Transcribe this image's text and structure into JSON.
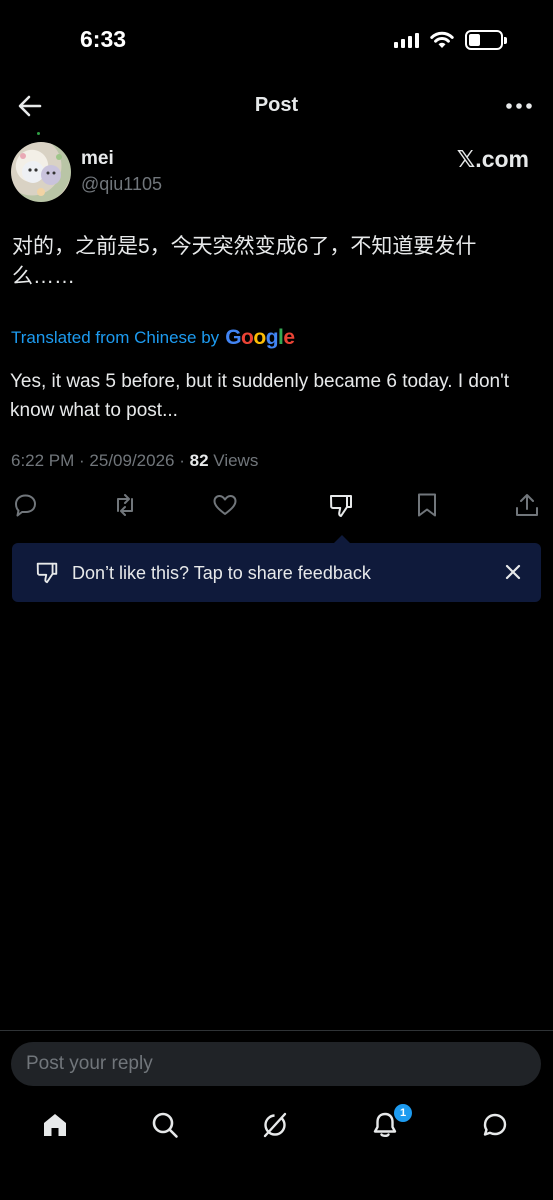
{
  "status_bar": {
    "time": "6:33",
    "battery_level": 0.35
  },
  "header": {
    "title": "Post"
  },
  "author": {
    "display_name": "mei",
    "handle": "@qiu1105",
    "source_label": "𝕏.com"
  },
  "post": {
    "text": "对的，之前是5，今天突然变成6了，不知道要发什么……",
    "translated_prefix": "Translated from Chinese by",
    "translator": "Google",
    "translation": "Yes, it was 5 before, but it suddenly became 6 today. I don't know what to post...",
    "time": "6:22 PM",
    "date": "25/09/2026",
    "views_count": "82",
    "views_label": "Views"
  },
  "tooltip": {
    "text": "Don’t like this? Tap to share feedback"
  },
  "reply": {
    "placeholder": "Post your reply"
  },
  "nav": {
    "notification_badge": "1"
  },
  "colors": {
    "accent": "#1d9bf0",
    "muted": "#71767b",
    "tooltip_bg": "#0f1a3b",
    "google_blue": "#4285F4",
    "google_red": "#EA4335",
    "google_yellow": "#FBBC05",
    "google_green": "#34A853"
  }
}
